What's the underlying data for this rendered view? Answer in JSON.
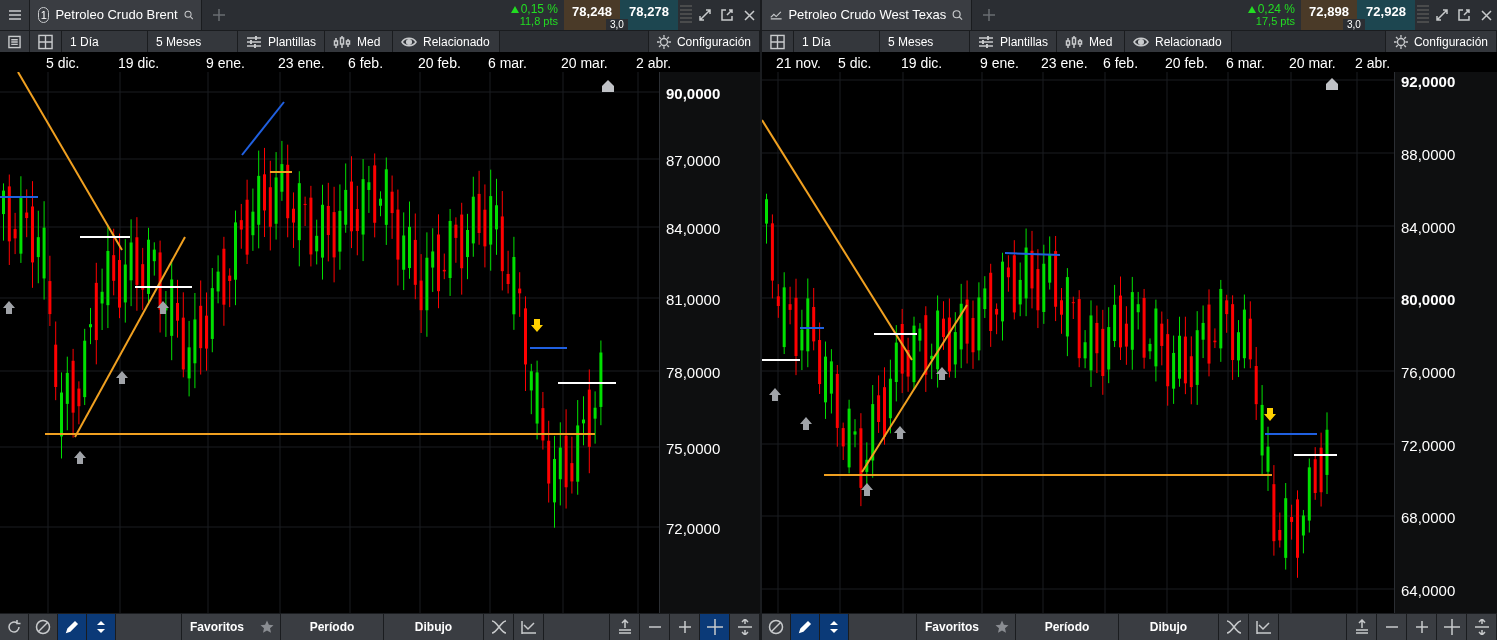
{
  "panels": [
    {
      "header": {
        "badge": "1",
        "title": "Petroleo Crudo Brent",
        "change": "0,15 %",
        "change_pts": "11,8 pts",
        "bid": "78,248",
        "ask": "78,278",
        "spread": "3,0"
      },
      "toolbar": {
        "list_button": true,
        "interval": "1 Día",
        "range": "5 Meses",
        "templates": "Plantillas",
        "studies": "Med",
        "related": "Relacionado",
        "settings": "Configuración"
      },
      "x_axis": [
        "5 dic.",
        "19 dic.",
        "9 ene.",
        "23 ene.",
        "6 feb.",
        "20 feb.",
        "6 mar.",
        "20 mar.",
        "2 abr."
      ],
      "y_axis": [
        {
          "label": "90,0000",
          "bold": true
        },
        {
          "label": "87,0000",
          "bold": false
        },
        {
          "label": "84,0000",
          "bold": false
        },
        {
          "label": "81,0000",
          "bold": false
        },
        {
          "label": "78,0000",
          "bold": false
        },
        {
          "label": "75,0000",
          "bold": false
        },
        {
          "label": "72,0000",
          "bold": false
        }
      ],
      "bottom_bar": {
        "left_tools": [
          {
            "kind": "refresh",
            "selected": false
          },
          {
            "kind": "no",
            "selected": false
          },
          {
            "kind": "pencil",
            "selected": true
          },
          {
            "kind": "arrows",
            "selected": true
          }
        ],
        "favorites": "Favoritos",
        "period": "Período",
        "drawing": "Dibujo",
        "right_tools": [
          {
            "kind": "wave",
            "selected": false
          },
          {
            "kind": "ruler",
            "selected": false
          },
          {
            "kind": "gap",
            "selected": false
          },
          {
            "kind": "anchor",
            "selected": false
          },
          {
            "kind": "minus",
            "selected": false
          },
          {
            "kind": "plus",
            "selected": false
          },
          {
            "kind": "crosshair",
            "selected": true
          },
          {
            "kind": "resize",
            "selected": false
          }
        ]
      }
    },
    {
      "header": {
        "title": "Petroleo Crudo West Texas",
        "change": "0,24 %",
        "change_pts": "17,5 pts",
        "bid": "72,898",
        "ask": "72,928",
        "spread": "3,0"
      },
      "toolbar": {
        "list_button": false,
        "interval": "1 Día",
        "range": "5 Meses",
        "templates": "Plantillas",
        "studies": "Med",
        "related": "Relacionado",
        "settings": "Configuración"
      },
      "x_axis": [
        "21 nov.",
        "5 dic.",
        "19 dic.",
        "9 ene.",
        "23 ene.",
        "6 feb.",
        "20 feb.",
        "6 mar.",
        "20 mar.",
        "2 abr."
      ],
      "y_axis": [
        {
          "label": "92,0000",
          "bold": true
        },
        {
          "label": "88,0000",
          "bold": false
        },
        {
          "label": "84,0000",
          "bold": false
        },
        {
          "label": "80,0000",
          "bold": true
        },
        {
          "label": "76,0000",
          "bold": false
        },
        {
          "label": "72,0000",
          "bold": false
        },
        {
          "label": "68,0000",
          "bold": false
        },
        {
          "label": "64,0000",
          "bold": false
        }
      ],
      "bottom_bar": {
        "left_tools": [
          {
            "kind": "no",
            "selected": false
          },
          {
            "kind": "pencil",
            "selected": true
          },
          {
            "kind": "arrows",
            "selected": true
          }
        ],
        "favorites": "Favoritos",
        "period": "Período",
        "drawing": "Dibujo",
        "right_tools": [
          {
            "kind": "wave",
            "selected": false
          },
          {
            "kind": "ruler",
            "selected": false
          },
          {
            "kind": "gap",
            "selected": false
          },
          {
            "kind": "anchor",
            "selected": false
          },
          {
            "kind": "minus",
            "selected": false
          },
          {
            "kind": "plus",
            "selected": false
          },
          {
            "kind": "crosshair",
            "selected": false
          },
          {
            "kind": "resize",
            "selected": false
          }
        ]
      }
    }
  ]
}
